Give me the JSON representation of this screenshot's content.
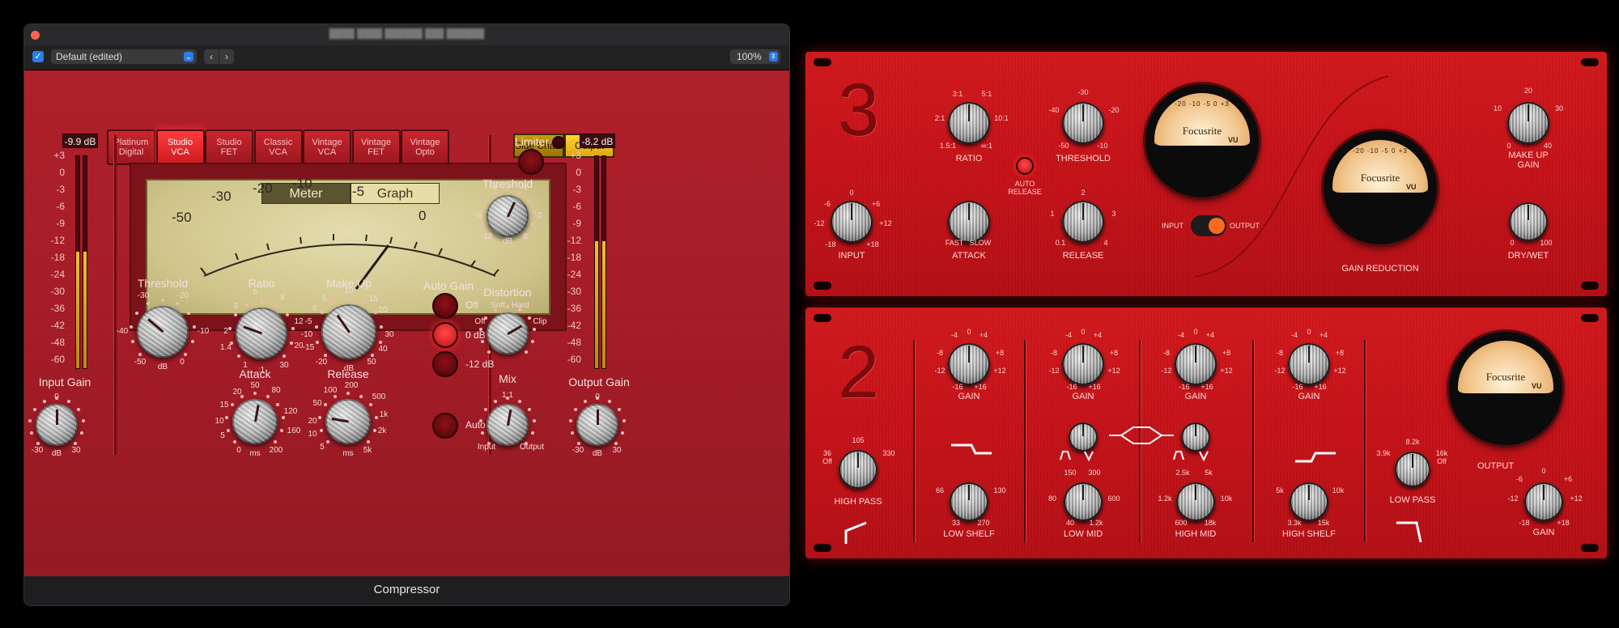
{
  "window": {
    "title": "Compressor",
    "enabled": true,
    "preset": "Default (edited)",
    "zoom": "100%"
  },
  "models": [
    "Platinum\nDigital",
    "Studio\nVCA",
    "Studio\nFET",
    "Classic\nVCA",
    "Vintage\nVCA",
    "Vintage\nFET",
    "Vintage\nOpto"
  ],
  "active_model": "Studio\nVCA",
  "routing": {
    "side_chain": "Side Chain",
    "output": "Output"
  },
  "meter": {
    "tab_meter": "Meter",
    "tab_graph": "Graph",
    "scale": [
      "-50",
      "-30",
      "-20",
      "-10",
      "-5",
      "0"
    ]
  },
  "input": {
    "readout": "-9.9 dB",
    "label": "Input Gain",
    "top": "0",
    "left": "-30",
    "right": "30",
    "unit": "dB",
    "level": 0.55
  },
  "output": {
    "readout": "-8.2 dB",
    "label": "Output Gain",
    "top": "0",
    "left": "-30",
    "right": "30",
    "unit": "dB",
    "level": 0.6
  },
  "level_scale": [
    "+3",
    "0",
    "-3",
    "-6",
    "-9",
    "-12",
    "-18",
    "-24",
    "-30",
    "-36",
    "-42",
    "-48",
    "-60"
  ],
  "knobs": {
    "threshold": {
      "label": "Threshold",
      "ticks": [
        "-30",
        "-20",
        "-40",
        "-10",
        "-50",
        "0",
        "dB"
      ]
    },
    "ratio": {
      "label": "Ratio",
      "ticks": [
        "5",
        "8",
        "3",
        "12",
        "2",
        "20",
        "1.4",
        "30",
        "1",
        ":1"
      ]
    },
    "makeup": {
      "label": "Make Up",
      "ticks": [
        "5",
        "10",
        "0",
        "15",
        "-5",
        "20",
        "-10",
        "30",
        "-15",
        "40",
        "-20",
        "50",
        "dB"
      ]
    },
    "attack": {
      "label": "Attack",
      "ticks": [
        "20",
        "50",
        "80",
        "15",
        "120",
        "10",
        "160",
        "5",
        "200",
        "0",
        "ms"
      ]
    },
    "release": {
      "label": "Release",
      "ticks": [
        "100",
        "200",
        "50",
        "500",
        "20",
        "1k",
        "10",
        "2k",
        "5",
        "5k",
        "ms"
      ]
    },
    "distortion": {
      "label": "Distortion",
      "ticks": [
        "Soft",
        "Hard",
        "Off",
        "Clip"
      ]
    },
    "mix": {
      "label": "Mix",
      "ticks": [
        "1:1",
        "Input",
        "Output"
      ]
    },
    "threshold2": {
      "label": "Threshold",
      "ticks": [
        "-6",
        "-4",
        "-8",
        "-2",
        "-10",
        "0",
        "dB"
      ]
    }
  },
  "auto_gain": {
    "label": "Auto Gain",
    "options": [
      "Off",
      "0 dB",
      "-12 dB"
    ],
    "selected": "0 dB",
    "auto": "Auto"
  },
  "limiter": {
    "label": "Limiter"
  },
  "hw_top": {
    "number": "3",
    "ratio": {
      "label": "RATIO",
      "ticks": [
        "3:1",
        "5:1",
        "2:1",
        "10:1",
        "1.5:1",
        "∞:1"
      ]
    },
    "threshold": {
      "label": "THRESHOLD",
      "ticks": [
        "-30",
        "-40",
        "-20",
        "-50",
        "-10"
      ]
    },
    "auto_release": "AUTO\nRELEASE",
    "input": {
      "label": "INPUT",
      "ticks": [
        "0",
        "-6",
        "+6",
        "-12",
        "+12",
        "-18",
        "+18"
      ]
    },
    "attack": {
      "label": "ATTACK",
      "ticks": [
        "FAST",
        "SLOW"
      ]
    },
    "release": {
      "label": "RELEASE",
      "ticks": [
        "2",
        "1",
        "3",
        "0.1",
        "4"
      ]
    },
    "switch": {
      "left": "INPUT",
      "right": "OUTPUT"
    },
    "gain_reduction": "GAIN REDUCTION",
    "makeup": {
      "label": "MAKE UP\nGAIN",
      "ticks": [
        "20",
        "10",
        "30",
        "0",
        "40"
      ]
    },
    "drywet": {
      "label": "DRY/WET",
      "ticks": [
        "0",
        "100"
      ]
    },
    "vu_brand": "Focusrite",
    "vu_tag": "VU",
    "vu_scale": "-20 -10 -5 0 +3"
  },
  "hw_bot": {
    "number": "2",
    "gain_ticks": [
      "-4",
      "0",
      "+4",
      "-8",
      "+8",
      "-12",
      "+12",
      "-16",
      "+16"
    ],
    "gain_label": "GAIN",
    "highpass": {
      "label": "HIGH PASS",
      "ticks": [
        "105",
        "36",
        "330",
        "Off"
      ]
    },
    "lowshelf": {
      "label": "LOW SHELF",
      "ticks": [
        "66",
        "130",
        "33",
        "270"
      ]
    },
    "lowmid": {
      "label": "LOW MID",
      "ticks": [
        "150",
        "300",
        "80",
        "600",
        "40",
        "1.2k"
      ]
    },
    "highmid": {
      "label": "HIGH MID",
      "ticks": [
        "2.5k",
        "5k",
        "1.2k",
        "10k",
        "600",
        "18k"
      ]
    },
    "highshelf": {
      "label": "HIGH SHELF",
      "ticks": [
        "5k",
        "10k",
        "3.3k",
        "15k"
      ]
    },
    "lowpass": {
      "label": "LOW PASS",
      "ticks": [
        "8.2k",
        "3.9k",
        "16k",
        "Off"
      ]
    },
    "output": {
      "label": "OUTPUT"
    },
    "outgain": {
      "label": "GAIN",
      "ticks": [
        "0",
        "-6",
        "+6",
        "-12",
        "+12",
        "-18",
        "+18"
      ]
    },
    "vu_brand": "Focusrite",
    "vu_tag": "VU"
  },
  "colors": {
    "plugin_red": "#a81c27",
    "hw_red": "#c41218",
    "meter_gold": "#d1c68f",
    "accent_blue": "#2a7dea",
    "output_yellow": "#f2c417"
  }
}
